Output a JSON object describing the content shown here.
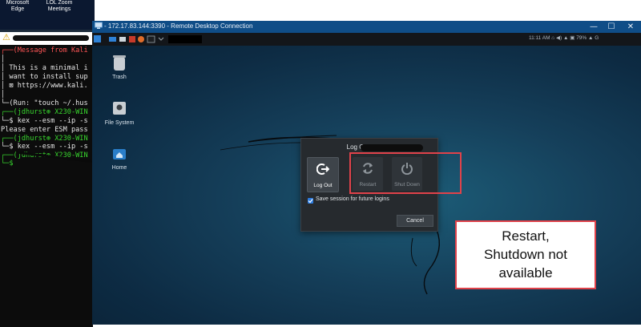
{
  "windows_desktop": {
    "shortcuts": [
      {
        "label": "Microsoft\nEdge"
      },
      {
        "label": "LOL Zoom\nMeetings"
      }
    ]
  },
  "terminal": {
    "lines": [
      {
        "text": "┌──(Message from Kali",
        "color": "red"
      },
      {
        "text": "│",
        "color": "white"
      },
      {
        "text": "│ This is a minimal i",
        "color": "white"
      },
      {
        "text": "│ want to install sup",
        "color": "white"
      },
      {
        "text": "│ ⊠ https://www.kali.",
        "color": "white"
      },
      {
        "text": "│",
        "color": "white"
      },
      {
        "text": "└─(Run: \"touch ~/.hus",
        "color": "white"
      },
      {
        "text": "┌──(jdhurst⊛ X230-WIN",
        "color": "green"
      },
      {
        "text": "└─$ kex --esm --ip -s",
        "color": "white"
      },
      {
        "text": "Please enter ESM pass",
        "color": "white"
      },
      {
        "text": "┌──(jdhurst⊛ X230-WIN",
        "color": "green"
      },
      {
        "text": "└─$ kex --esm --ip -s",
        "color": "white"
      },
      {
        "text": "┌──(jdhurst⊛ X230-WIN",
        "color": "green"
      },
      {
        "text": "└─$ ",
        "color": "green"
      }
    ]
  },
  "rdp": {
    "title": "- 172.17.83.144:3390 - Remote Desktop Connection",
    "controls": {
      "minimize": "—",
      "maximize": "☐",
      "close": "✕"
    }
  },
  "kali_panel": {
    "status": "11:11 AM  ⌂  ◀)  ▲  ▣ 79%  ▲  G"
  },
  "kali_desktop": {
    "icons": [
      {
        "label": "Trash"
      },
      {
        "label": "File System"
      },
      {
        "label": "Home"
      }
    ]
  },
  "logout_dialog": {
    "title": "Log Out jdhurst",
    "buttons": [
      {
        "label": "Log Out",
        "enabled": true
      },
      {
        "label": "Restart",
        "enabled": false
      },
      {
        "label": "Shut Down",
        "enabled": false
      }
    ],
    "save_session_label": "Save session for future logins",
    "save_session_checked": true,
    "cancel_label": "Cancel"
  },
  "annotation": {
    "callout_text": "Restart,\nShutdown not\navailable",
    "color": "#e0424a"
  }
}
